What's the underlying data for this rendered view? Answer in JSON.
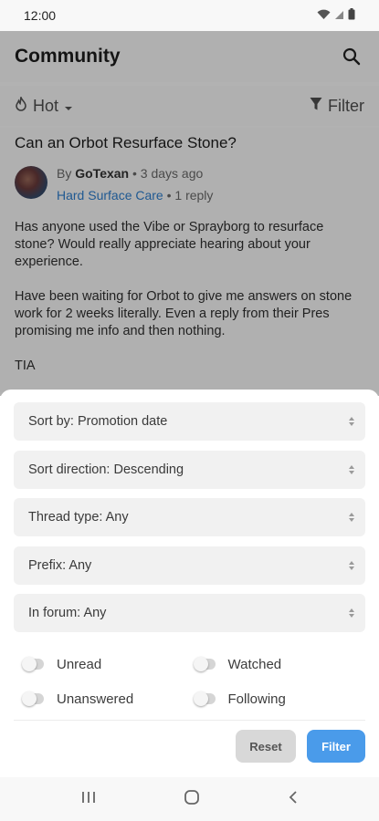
{
  "status_bar": {
    "time": "12:00"
  },
  "app_bar": {
    "title": "Community"
  },
  "filter_bar": {
    "sort_label": "Hot",
    "filter_label": "Filter"
  },
  "thread": {
    "title": "Can an Orbot Resurface Stone?",
    "by_prefix": "By",
    "author": "GoTexan",
    "time_ago": "• 3 days ago",
    "forum": "Hard Surface Care",
    "replies": "• 1 reply",
    "body": [
      "Has anyone used the Vibe or Sprayborg to resurface stone? Would really appreciate hearing about your experience.",
      "Have been waiting for Orbot to give me answers on stone work for 2 weeks literally. Even a reply from their Pres promising me info and then nothing.",
      "TIA"
    ]
  },
  "sheet": {
    "selects": [
      "Sort by: Promotion date",
      "Sort direction: Descending",
      "Thread type: Any",
      "Prefix: Any",
      "In forum: Any"
    ],
    "toggles": {
      "unread": {
        "label": "Unread",
        "on": false
      },
      "watched": {
        "label": "Watched",
        "on": false
      },
      "unanswered": {
        "label": "Unanswered",
        "on": false
      },
      "following": {
        "label": "Following",
        "on": false
      }
    },
    "reset_label": "Reset",
    "filter_label": "Filter"
  },
  "colors": {
    "accent": "#4a9bea",
    "link": "#2f80d1"
  }
}
